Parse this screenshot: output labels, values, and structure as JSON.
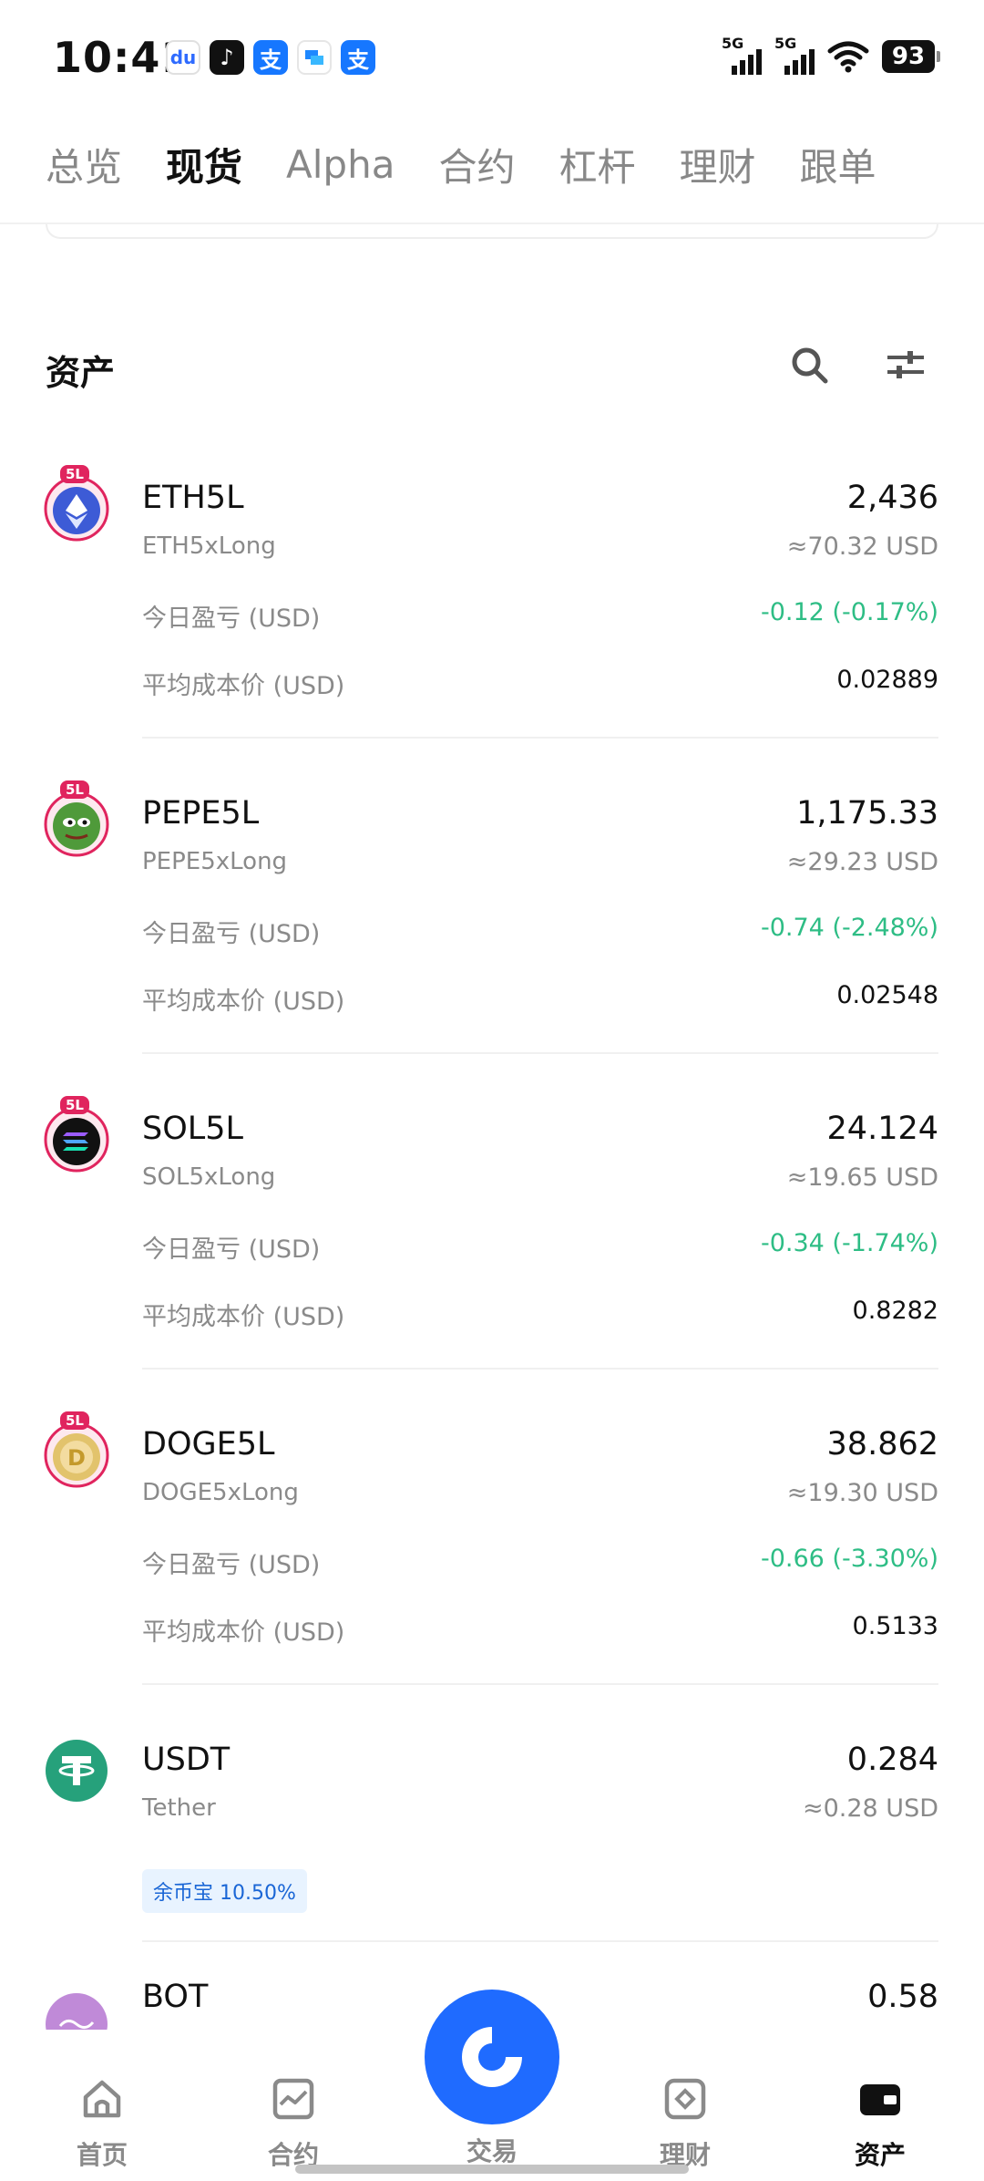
{
  "status_bar": {
    "time": "10:41",
    "baidu_glyph": "du",
    "tiktok_glyph": "♪",
    "alipay_glyph": "支",
    "signal_label": "5G",
    "battery": "93"
  },
  "tabs": [
    {
      "label": "总览"
    },
    {
      "label": "现货",
      "active": true
    },
    {
      "label": "Alpha"
    },
    {
      "label": "合约"
    },
    {
      "label": "杠杆"
    },
    {
      "label": "理财"
    },
    {
      "label": "跟单"
    }
  ],
  "assets_section": {
    "title": "资产",
    "search_icon": "search-icon",
    "filter_icon": "sliders-icon"
  },
  "labels": {
    "pnl_today": "今日盈亏 (USD)",
    "avg_cost": "平均成本价 (USD)",
    "badge_5l": "5L"
  },
  "assets": [
    {
      "symbol": "ETH5L",
      "name": "ETH5xLong",
      "amount": "2,436",
      "usd": "≈70.32 USD",
      "pnl": "-0.12 (-0.17%)",
      "cost": "0.02889"
    },
    {
      "symbol": "PEPE5L",
      "name": "PEPE5xLong",
      "amount": "1,175.33",
      "usd": "≈29.23 USD",
      "pnl": "-0.74 (-2.48%)",
      "cost": "0.02548"
    },
    {
      "symbol": "SOL5L",
      "name": "SOL5xLong",
      "amount": "24.124",
      "usd": "≈19.65 USD",
      "pnl": "-0.34 (-1.74%)",
      "cost": "0.8282"
    },
    {
      "symbol": "DOGE5L",
      "name": "DOGE5xLong",
      "amount": "38.862",
      "usd": "≈19.30 USD",
      "pnl": "-0.66 (-3.30%)",
      "cost": "0.5133"
    },
    {
      "symbol": "USDT",
      "name": "Tether",
      "amount": "0.284",
      "usd": "≈0.28 USD",
      "badge": "余币宝 10.50%"
    },
    {
      "symbol": "BOT",
      "amount": "0.58"
    }
  ],
  "bottom_nav": {
    "home": "首页",
    "futures": "合约",
    "trade": "交易",
    "earn": "理财",
    "assets": "资产"
  },
  "colors": {
    "accent": "#1f6bff",
    "profit_green": "#2ebd85",
    "muted": "#8a8a8a"
  }
}
